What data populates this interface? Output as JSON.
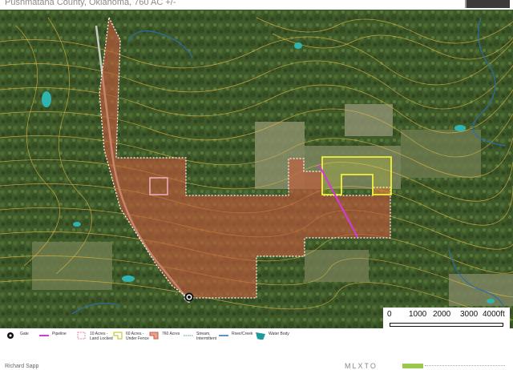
{
  "header": {
    "title": "Pushmataha County, Oklahoma, 760 AC +/-"
  },
  "map": {
    "scale_bar": {
      "labels": [
        "0",
        "1000",
        "2000",
        "3000",
        "4000ft"
      ]
    },
    "markers": [
      {
        "name": "gate-marker",
        "icon": "gate-icon"
      }
    ],
    "colors": {
      "property_fill": "#c85a3c",
      "property_border": "#ffffff",
      "fenced_area": "#f2f23a",
      "pipeline": "#d23cd2",
      "contour_lines": "#e0b440",
      "creek": "#2a6ea8",
      "water_body": "#30b4b0"
    }
  },
  "legend": {
    "items": [
      {
        "label": "Gate",
        "icon": "gate-icon"
      },
      {
        "label": "Pipeline",
        "icon": "pipeline-line-icon"
      },
      {
        "label": "10 Acres -\nLand Locked",
        "icon": "dashed-pink-square-icon"
      },
      {
        "label": "60 Acres -\nUnder Fence",
        "icon": "yellow-outline-icon"
      },
      {
        "label": "760 Acres",
        "icon": "red-polygon-icon"
      },
      {
        "label": "Stream,\nIntermittent",
        "icon": "dotted-line-icon"
      },
      {
        "label": "River/Creek",
        "icon": "blue-line-icon"
      },
      {
        "label": "Water Body",
        "icon": "water-body-icon"
      }
    ]
  },
  "footer": {
    "author": "Richard Sapp",
    "brand": "MLXTO"
  }
}
